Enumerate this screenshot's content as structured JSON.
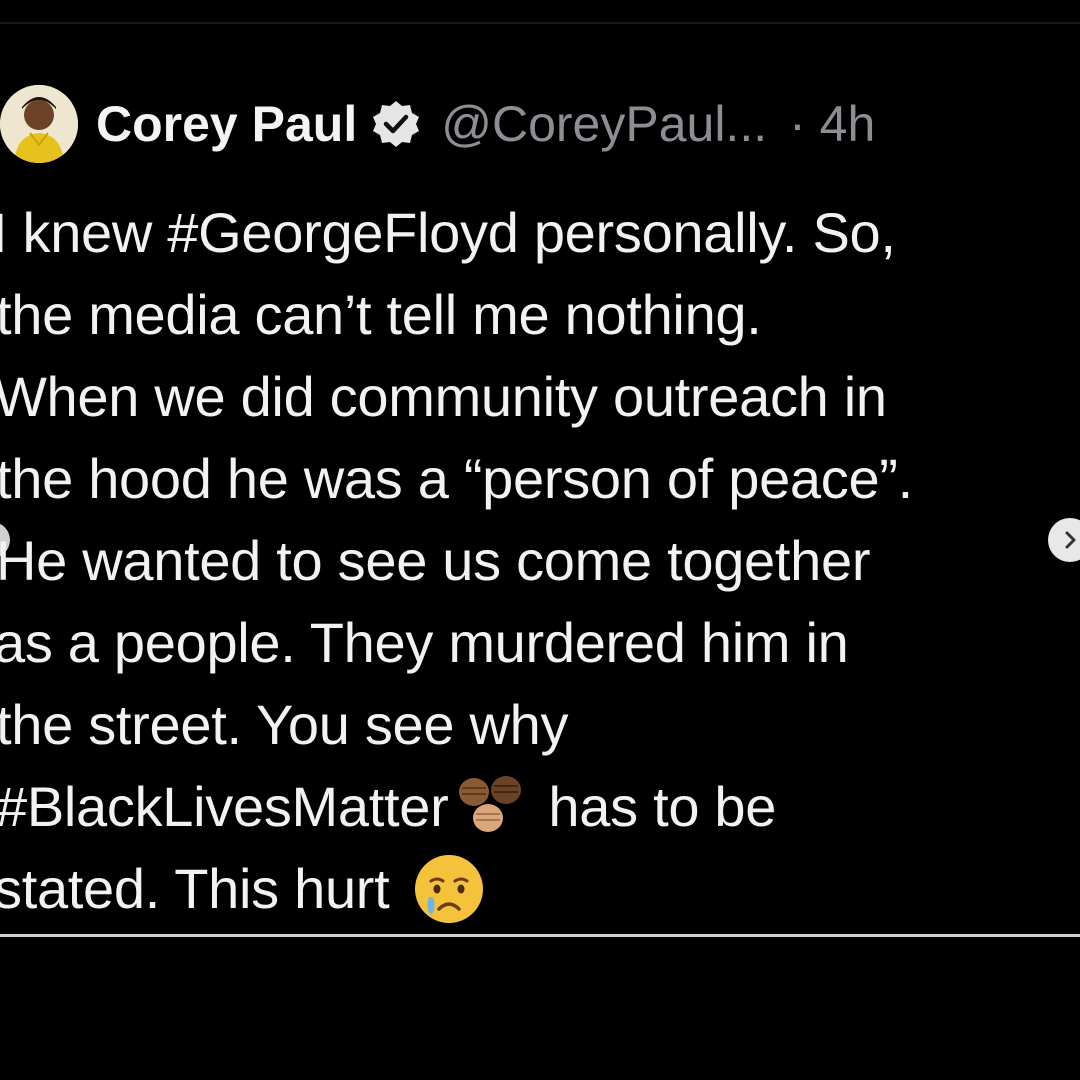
{
  "tweet": {
    "display_name": "Corey Paul",
    "handle": "@CoreyPaul...",
    "time": "· 4h",
    "lines": [
      "I knew #GeorgeFloyd personally. So,",
      "the media can’t tell me nothing.",
      "When we did community outreach in",
      "the hood he was a “person of peace”.",
      "He wanted to see us come together",
      "as a people. They murdered him in",
      "the street. You see why",
      "#BlackLivesMatter",
      "has to be",
      "stated. This hurt"
    ]
  },
  "icons": {
    "verified": "verified-badge-icon",
    "fist_emoji": "raised-fists-emoji",
    "cry_emoji": "crying-face-emoji",
    "next": "chevron-right-icon",
    "prev": "chevron-left-icon"
  },
  "colors": {
    "background": "#000000",
    "text": "#f2f2f2",
    "muted": "#8b8f94",
    "verified_badge": "#e6e6e6"
  }
}
